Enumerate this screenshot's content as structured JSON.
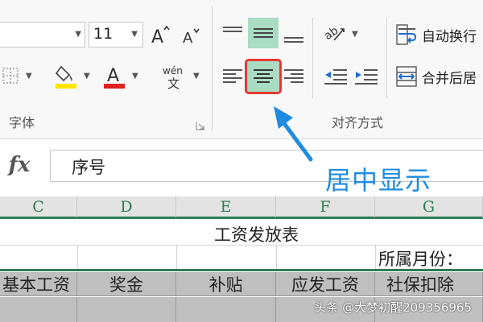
{
  "ribbon": {
    "font_group": {
      "font_size": "11",
      "label": "字体",
      "increase_icon": "increase-font-size-icon",
      "decrease_icon": "decrease-font-size-icon",
      "fill_color": "#ffe600",
      "font_color": "#e02020"
    },
    "alignment_group": {
      "label": "对齐方式",
      "wrap_text": "自动换行",
      "merge_center": "合并后居",
      "active_color": "#a9dcc2",
      "highlight_border": "#e53935"
    }
  },
  "formula_bar": {
    "fx": "fx",
    "value": "序号"
  },
  "annotation": {
    "text": "居中显示",
    "color": "#1f8be0"
  },
  "sheet": {
    "columns": [
      "C",
      "D",
      "E",
      "F",
      "G"
    ],
    "title": "工资发放表",
    "month_label": "所属月份：",
    "headers": [
      "基本工资",
      "奖金",
      "补贴",
      "应发工资",
      "社保扣除"
    ]
  },
  "watermark": "头条 @大梦初醒209356965"
}
